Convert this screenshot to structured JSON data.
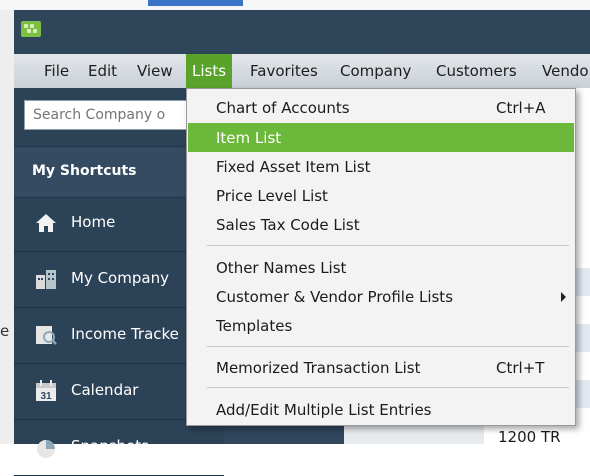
{
  "menubar": {
    "items": [
      {
        "label": "File"
      },
      {
        "label": "Edit"
      },
      {
        "label": "View"
      },
      {
        "label": "Lists",
        "active": true
      },
      {
        "label": "Favorites"
      },
      {
        "label": "Company"
      },
      {
        "label": "Customers"
      },
      {
        "label": "Vendo"
      }
    ]
  },
  "sidebar": {
    "search_placeholder": "Search Company o",
    "header": "My Shortcuts",
    "items": [
      {
        "label": "Home",
        "icon": "home-icon"
      },
      {
        "label": "My Company",
        "icon": "my-company-icon"
      },
      {
        "label": "Income Tracke",
        "icon": "income-tracker-icon"
      },
      {
        "label": "Calendar",
        "icon": "calendar-icon",
        "icon_text": "31"
      },
      {
        "label": "Snapshots",
        "icon": "snapshots-icon"
      }
    ]
  },
  "lists_menu": {
    "items": [
      {
        "label": "Chart of Accounts",
        "shortcut": "Ctrl+A"
      },
      {
        "label": "Item List",
        "highlighted": true
      },
      {
        "label": "Fixed Asset Item List"
      },
      {
        "label": "Price Level List"
      },
      {
        "label": "Sales Tax Code List"
      },
      {
        "label": "Other Names List"
      },
      {
        "label": "Customer & Vendor Profile Lists",
        "submenu": true
      },
      {
        "label": "Templates"
      },
      {
        "label": "Memorized Transaction List",
        "shortcut": "Ctrl+T"
      },
      {
        "label": "Add/Edit Multiple List Entries"
      }
    ]
  },
  "background": {
    "left_edge_text": "e",
    "right_bottom_text": "1200 TR"
  },
  "colors": {
    "sidebar": "#2c4257",
    "menu_active": "#5aa32b",
    "menu_highlight": "#6cb83a"
  }
}
